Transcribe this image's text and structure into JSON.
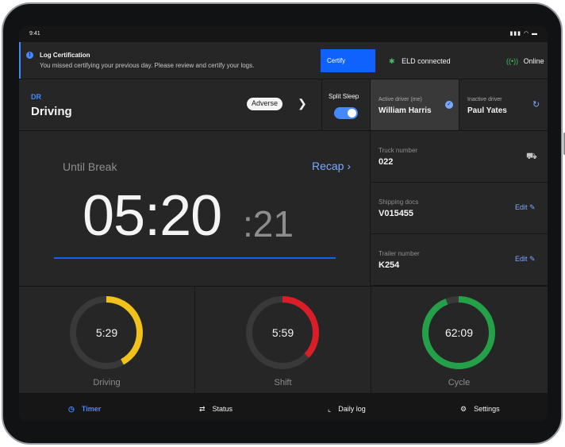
{
  "statusbar": {
    "time": "9:41",
    "system_indicators": "▮▮▮ ◠ ▬"
  },
  "alert": {
    "title": "Log Certification",
    "message": "You missed certifying your previous day. Please review and certify your logs.",
    "certify_label": "Certify",
    "eld_label": "ELD connected",
    "online_label": "Online"
  },
  "duty_status": {
    "code": "DR",
    "name": "Driving",
    "badge": "Adverse"
  },
  "split_sleep": {
    "label": "Split Sleep",
    "enabled": true
  },
  "drivers": {
    "active": {
      "label": "Active driver (me)",
      "name": "William Harris"
    },
    "inactive": {
      "label": "Inactive driver",
      "name": "Paul Yates"
    }
  },
  "timer": {
    "label": "Until Break",
    "recap_label": "Recap ›",
    "main_time": "05:20",
    "seconds": ":21",
    "progress": 1.0
  },
  "vehicle": {
    "truck": {
      "label": "Truck number",
      "value": "022"
    },
    "shipping": {
      "label": "Shipping docs",
      "value": "V015455",
      "edit_label": "Edit ✎"
    },
    "trailer": {
      "label": "Trailer number",
      "value": "K254",
      "edit_label": "Edit ✎"
    }
  },
  "gauges": [
    {
      "value": "5:29",
      "label": "Driving",
      "fraction": 0.42,
      "color": "#f1c21b"
    },
    {
      "value": "5:59",
      "label": "Shift",
      "fraction": 0.37,
      "color": "#da1e28"
    },
    {
      "value": "62:09",
      "label": "Cycle",
      "fraction": 0.94,
      "color": "#24a148"
    }
  ],
  "colors": {
    "accent": "#0f62fe",
    "background": "#161616",
    "panel": "#262626"
  },
  "tabs": [
    {
      "label": "Timer",
      "icon": "timer-icon",
      "active": true
    },
    {
      "label": "Status",
      "icon": "swap-icon",
      "active": false
    },
    {
      "label": "Daily log",
      "icon": "chart-icon",
      "active": false
    },
    {
      "label": "Settings",
      "icon": "gear-icon",
      "active": false
    }
  ]
}
